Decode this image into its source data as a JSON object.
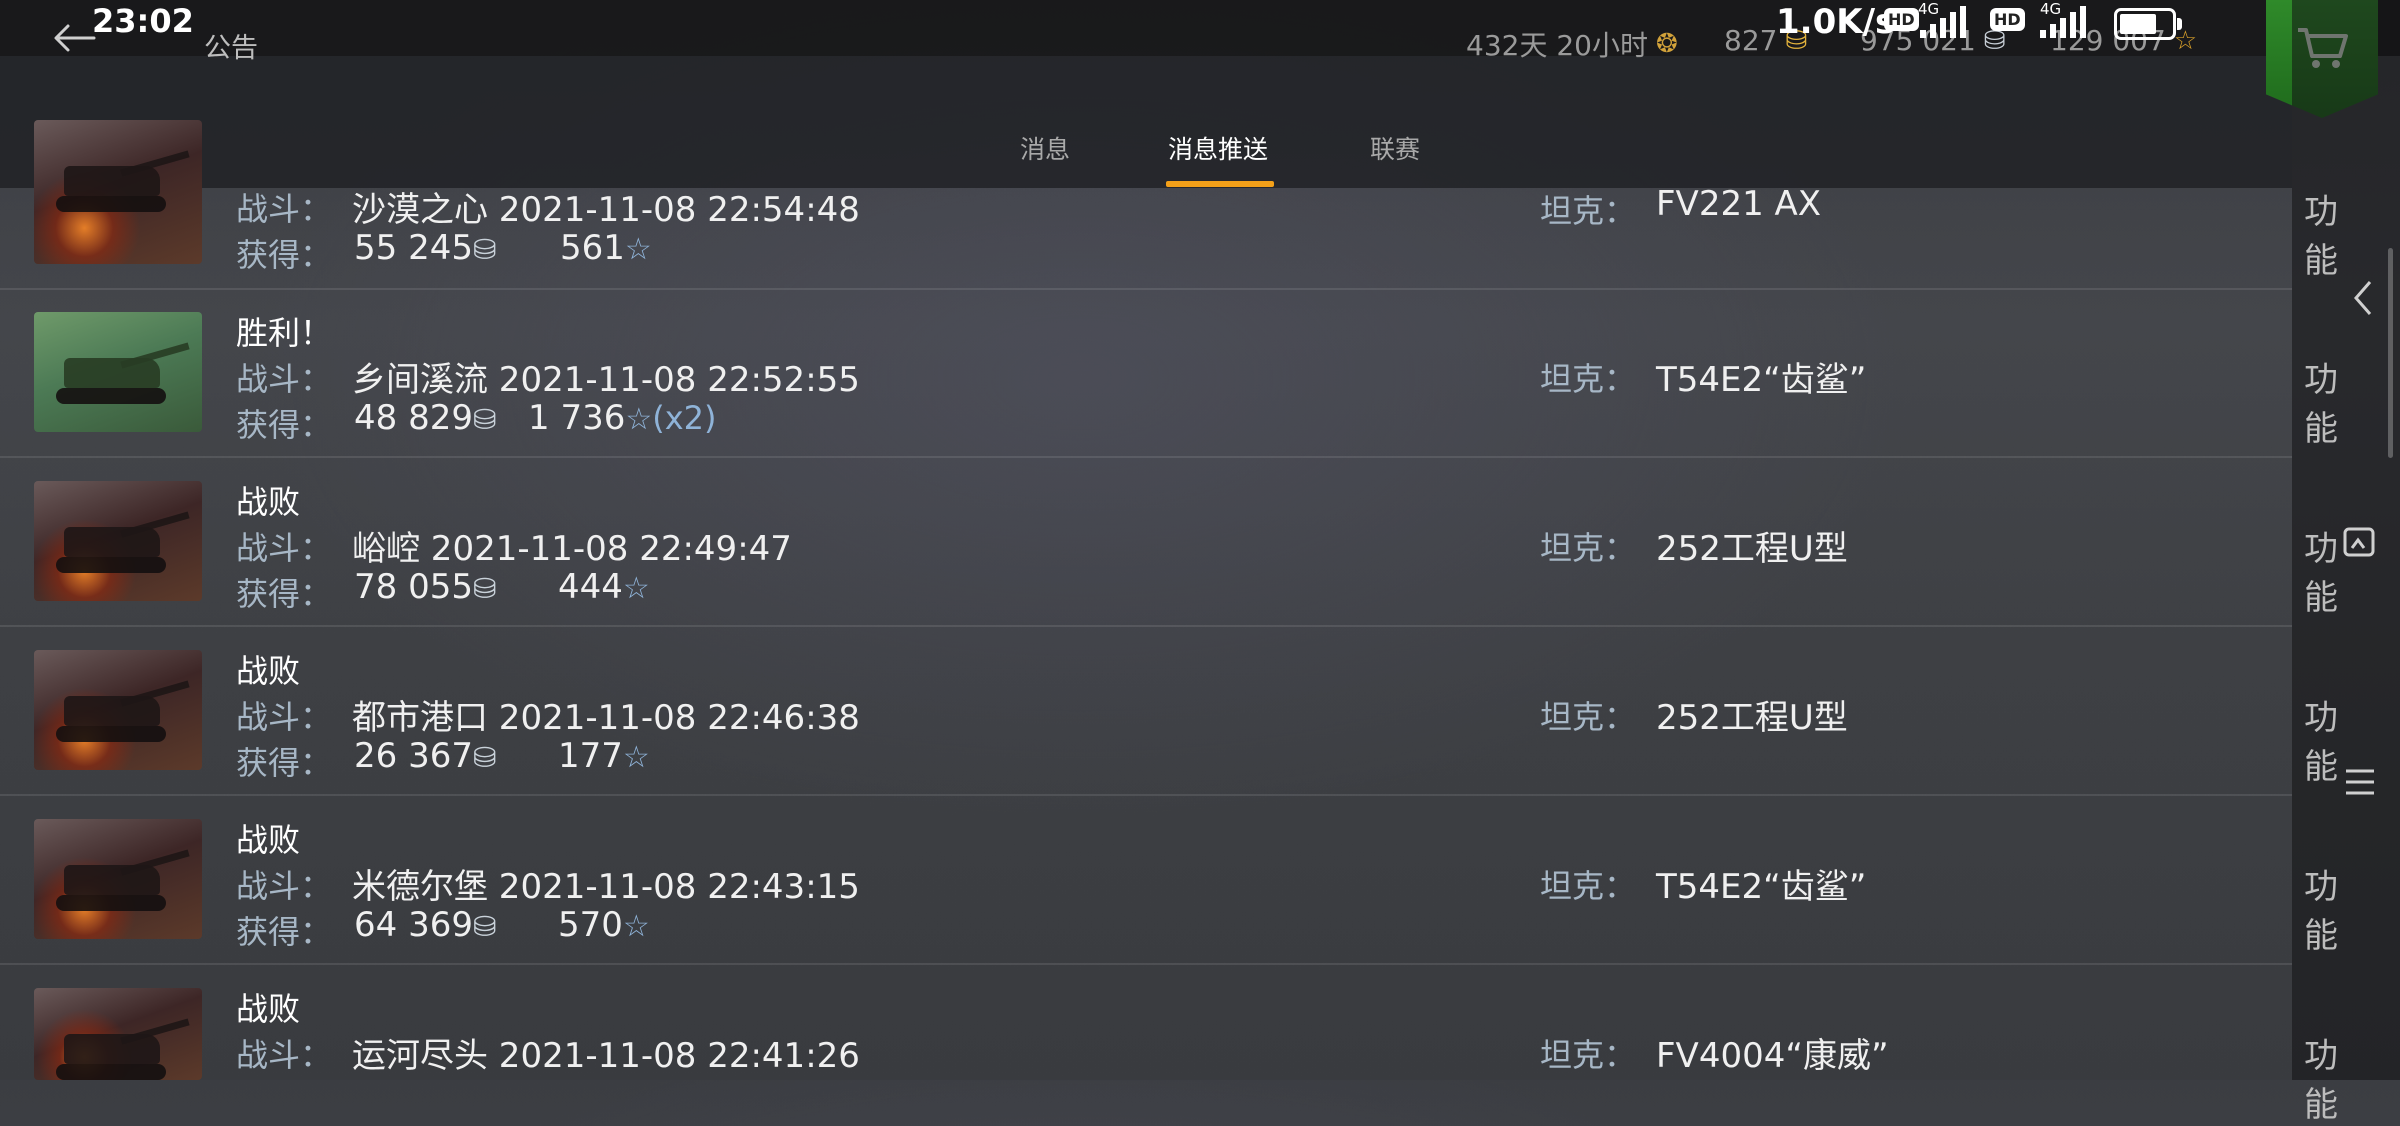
{
  "status_bar": {
    "time": "23:02",
    "net_speed": "1.0K/s",
    "hd1": "HD",
    "net1": "4G",
    "hd2": "HD",
    "net2": "4G"
  },
  "header": {
    "title": "公告",
    "service_time": "432天 20小时",
    "gold": "827",
    "silver": "975 021",
    "free_xp": "129 007"
  },
  "tabs": [
    {
      "label": "消息",
      "active": false
    },
    {
      "label": "消息推送",
      "active": true
    },
    {
      "label": "联赛",
      "active": false
    }
  ],
  "labels": {
    "battle": "战斗：",
    "earned": "获得：",
    "tank": "坦克：",
    "function": "功能"
  },
  "battles": [
    {
      "result": "",
      "map": "沙漠之心 2021-11-08 22:54:48",
      "credits": "55 245",
      "xp": "561",
      "mult": "",
      "tank": "FV221 AX",
      "thumb": "lose"
    },
    {
      "result": "胜利！",
      "map": "乡间溪流 2021-11-08 22:52:55",
      "credits": "48 829",
      "xp": "1 736",
      "mult": "(x2)",
      "tank": "T54E2“齿鲨”",
      "thumb": "win"
    },
    {
      "result": "战败",
      "map": "峪崆 2021-11-08 22:49:47",
      "credits": "78 055",
      "xp": "444",
      "mult": "",
      "tank": "252工程U型",
      "thumb": "lose"
    },
    {
      "result": "战败",
      "map": "都市港口 2021-11-08 22:46:38",
      "credits": "26 367",
      "xp": "177",
      "mult": "",
      "tank": "252工程U型",
      "thumb": "lose"
    },
    {
      "result": "战败",
      "map": "米德尔堡 2021-11-08 22:43:15",
      "credits": "64 369",
      "xp": "570",
      "mult": "",
      "tank": "T54E2“齿鲨”",
      "thumb": "lose"
    },
    {
      "result": "战败",
      "map": "运河尽头 2021-11-08 22:41:26",
      "credits": "",
      "xp": "",
      "mult": "",
      "tank": "FV4004“康威”",
      "thumb": "lose"
    }
  ],
  "icons": {
    "back": "back-arrow-icon",
    "medal": "medal-icon",
    "gold_coin": "gold-coin-icon",
    "silver_coin": "silver-coin-icon",
    "star": "star-icon",
    "cart": "cart-icon"
  },
  "colors": {
    "accent": "#f3a019",
    "shop_green": "#2f8a2a",
    "label_blue": "#a7b7c6",
    "star_blue": "#8fb3d8"
  },
  "battery_level": 0.82
}
